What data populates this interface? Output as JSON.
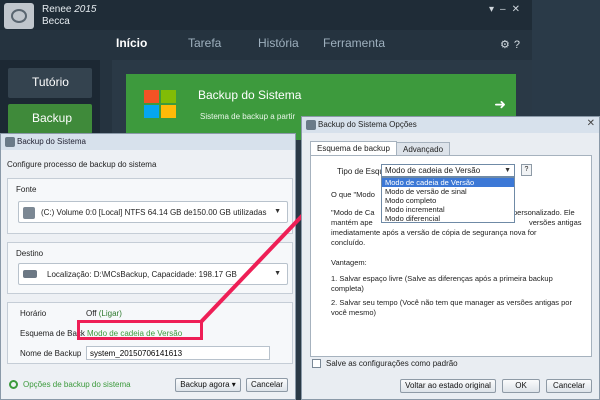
{
  "app": {
    "brand": "Renee",
    "version": "2015",
    "subtitle": "Becca",
    "nav": [
      "Início",
      "Tarefa",
      "História",
      "Ferramenta"
    ],
    "side": [
      "Tutório",
      "Backup"
    ],
    "card_title": "Backup do Sistema",
    "card_desc": "Sistema de backup a partir"
  },
  "left_dialog": {
    "title": "Backup do Sistema",
    "config_label": "Configure processo de backup do sistema",
    "fonte_label": "Fonte",
    "fonte_value": "(C:) Volume 0:0 [Local]   NTFS   64.14 GB de150.00 GB utilizadas",
    "destino_label": "Destino",
    "destino_value": "Localização: D:\\MCsBackup, Capacidade: 198.17 GB",
    "horario_label": "Horário",
    "horario_value": "Off",
    "horario_link": "(Ligar)",
    "esquema_label": "Esquema de Back",
    "esquema_value": "Modo de cadeia de Versão",
    "nome_label": "Nome de Backup",
    "nome_value": "system_20150706141613",
    "footer_link": "Opções de backup do sistema",
    "backup_button": "Backup agora ▾",
    "cancel_button": "Cancelar"
  },
  "right_dialog": {
    "title": "Backup do Sistema Opções",
    "tabs": [
      "Esquema de backup",
      "Advançado"
    ],
    "tipo_label": "Tipo de Esquer",
    "tipo_selected": "Modo de cadeia de Versão",
    "help": "?",
    "options": [
      "Modo de cadeia de Versão",
      "Modo de versão de sinal",
      "Modo completo",
      "Modo incremental",
      "Modo diferencial"
    ],
    "desc_q": "O que \"Modo",
    "desc_line1_left": "\"Modo de Ca",
    "desc_line1_right": "personalizado. Ele",
    "desc_line2_left": "mantém ape",
    "desc_line2_right": "versões antigas",
    "desc_line3": "imediatamente após a versão de cópia de segurança nova for",
    "desc_line4": "concluído.",
    "vant_title": "Vantagem:",
    "vant_1": "1. Salvar espaço livre (Salve as diferenças após a primeira backup completa)",
    "vant_2": "2. Salvar seu tempo (Você não tem que manager as versões antigas por você mesmo)",
    "save_default": "Salve as configurações como padrão",
    "restore_button": "Voltar ao estado original",
    "ok_button": "OK",
    "cancel_button": "Cancelar"
  },
  "colors": {
    "accent_green": "#3d9a3d",
    "highlight_red": "#ee1f56",
    "selection_blue": "#3c78d6"
  }
}
